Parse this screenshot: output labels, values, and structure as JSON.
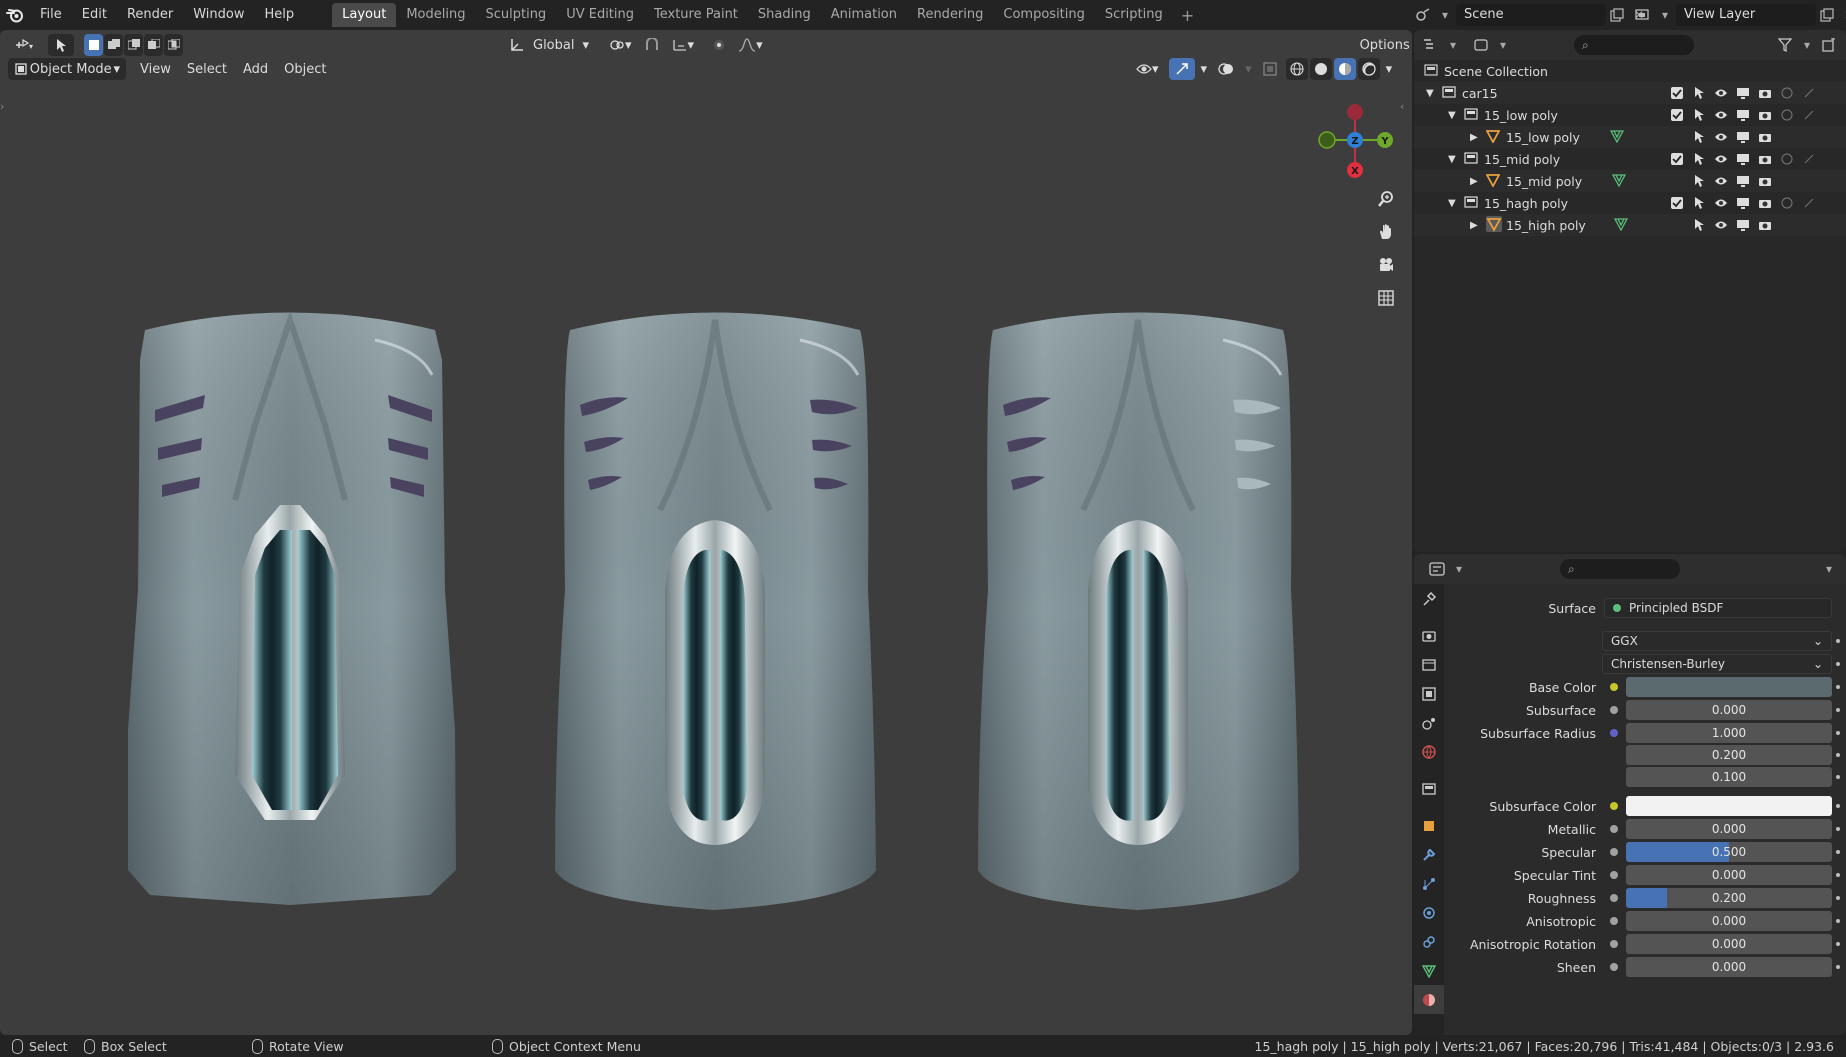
{
  "menu": [
    "File",
    "Edit",
    "Render",
    "Window",
    "Help"
  ],
  "workspaces": {
    "tabs": [
      "Layout",
      "Modeling",
      "Sculpting",
      "UV Editing",
      "Texture Paint",
      "Shading",
      "Animation",
      "Rendering",
      "Compositing",
      "Scripting"
    ],
    "active": "Layout",
    "add_label": "+"
  },
  "scene": {
    "name": "Scene",
    "view_layer": "View Layer"
  },
  "viewport": {
    "transform_orientation": "Global",
    "options_label": "Options",
    "mode": "Object Mode",
    "menus": [
      "View",
      "Select",
      "Add",
      "Object"
    ],
    "gizmo": {
      "x": "X",
      "y": "Y",
      "z": "Z"
    }
  },
  "outliner": {
    "root": "Scene Collection",
    "rows": [
      {
        "label": "car15",
        "kind": "collection"
      },
      {
        "label": "15_low poly",
        "kind": "collection"
      },
      {
        "label": "15_low poly",
        "kind": "object"
      },
      {
        "label": "15_mid poly",
        "kind": "collection"
      },
      {
        "label": "15_mid poly",
        "kind": "object"
      },
      {
        "label": "15_hagh poly",
        "kind": "collection"
      },
      {
        "label": "15_high poly",
        "kind": "object"
      }
    ]
  },
  "properties": {
    "surface_label": "Surface",
    "surface_value": "Principled BSDF",
    "distribution": "GGX",
    "subsurface_method": "Christensen-Burley",
    "base_color_label": "Base Color",
    "subsurface_label": "Subsurface",
    "subsurface_value": "0.000",
    "subsurface_radius_label": "Subsurface Radius",
    "subsurface_radius": [
      "1.000",
      "0.200",
      "0.100"
    ],
    "subsurface_color_label": "Subsurface Color",
    "metallic_label": "Metallic",
    "metallic_value": "0.000",
    "specular_label": "Specular",
    "specular_value": "0.500",
    "specular_fill": 0.5,
    "specular_tint_label": "Specular Tint",
    "specular_tint_value": "0.000",
    "roughness_label": "Roughness",
    "roughness_value": "0.200",
    "roughness_fill": 0.2,
    "anisotropic_label": "Anisotropic",
    "anisotropic_value": "0.000",
    "anisotropic_rotation_label": "Anisotropic Rotation",
    "anisotropic_rotation_value": "0.000",
    "sheen_label": "Sheen",
    "sheen_value": "0.000"
  },
  "statusbar": {
    "select": "Select",
    "box_select": "Box Select",
    "rotate_view": "Rotate View",
    "context_menu": "Object Context Menu",
    "stats": "15_hagh poly | 15_high poly | Verts:21,067 | Faces:20,796 | Tris:41,484 | Objects:0/3 | 2.93.6"
  },
  "colors": {
    "accent": "#4772b3",
    "viewport_bg": "#3d3d3d",
    "car_body": "#7d8d92",
    "axis_x": "#e0303f",
    "axis_y": "#6ea82b",
    "axis_z": "#2e7fd8"
  }
}
